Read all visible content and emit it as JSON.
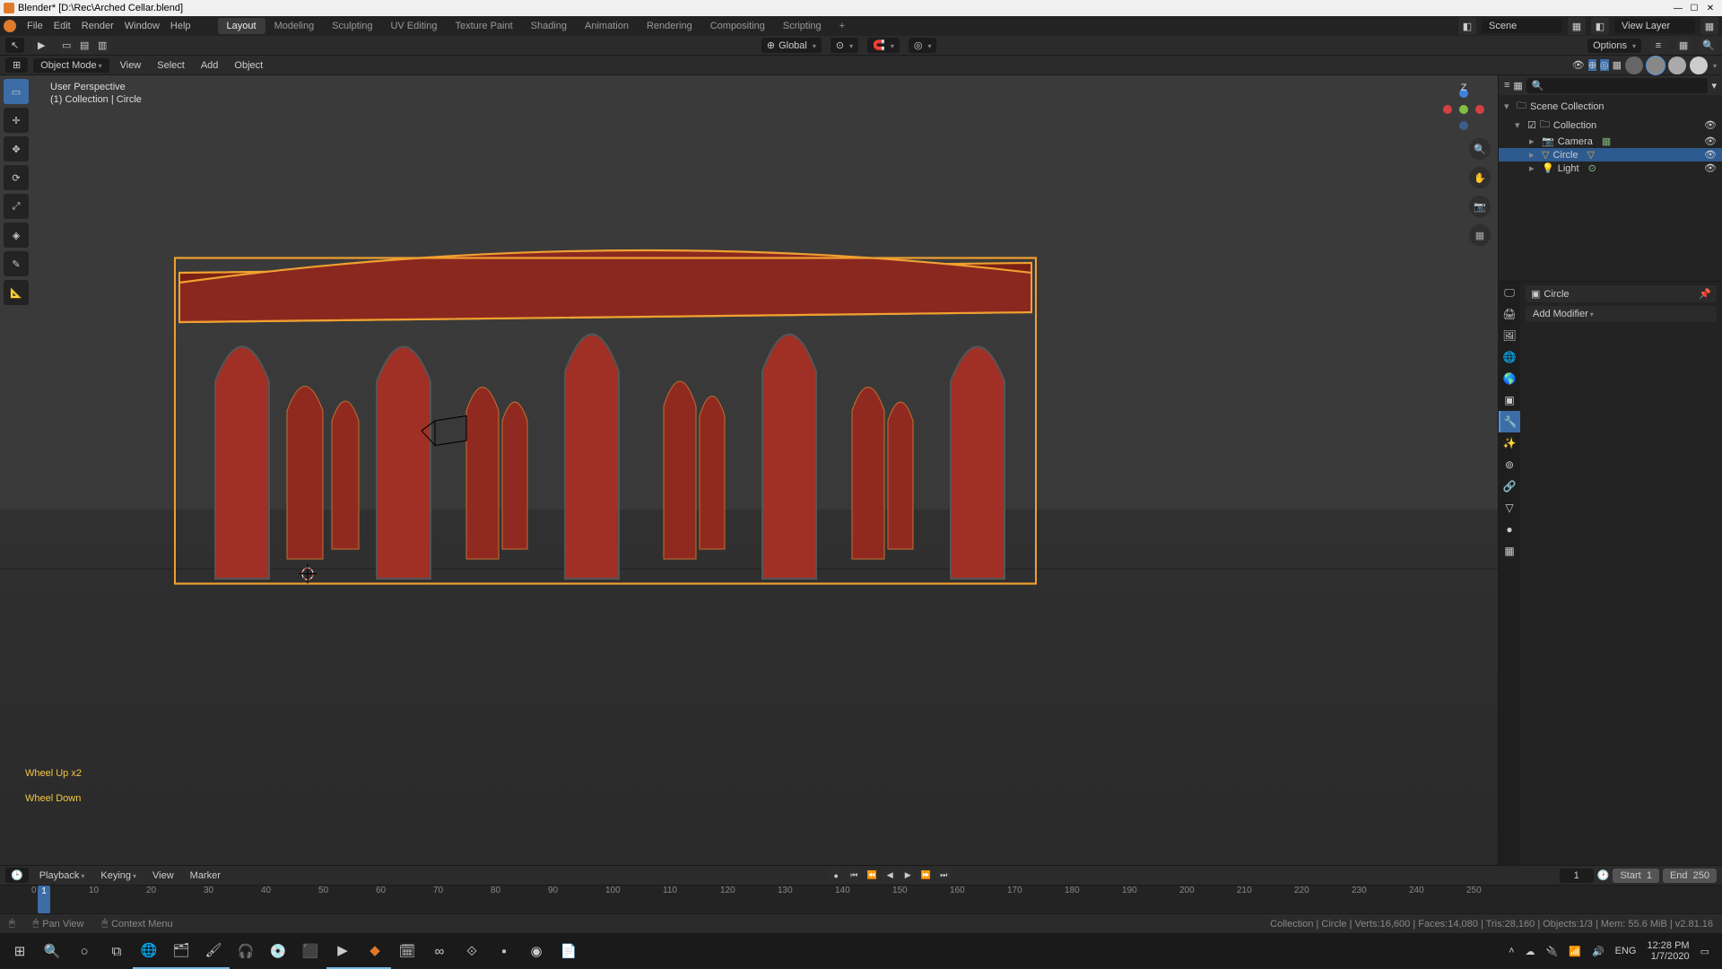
{
  "title": "Blender* [D:\\Rec\\Arched Cellar.blend]",
  "winbtns": {
    "min": "—",
    "max": "☐",
    "close": "✕"
  },
  "menu": {
    "file": "File",
    "edit": "Edit",
    "render": "Render",
    "window": "Window",
    "help": "Help"
  },
  "workspaces": {
    "layout": "Layout",
    "modeling": "Modeling",
    "sculpting": "Sculpting",
    "uv": "UV Editing",
    "texpaint": "Texture Paint",
    "shading": "Shading",
    "animation": "Animation",
    "rendering": "Rendering",
    "compositing": "Compositing",
    "scripting": "Scripting",
    "plus": "+"
  },
  "scene_field": "Scene",
  "viewlayer_field": "View Layer",
  "toolhdr": {
    "global": "Global",
    "options": "Options"
  },
  "mode_dd": "Object Mode",
  "viewmenu": {
    "view": "View",
    "select": "Select",
    "add": "Add",
    "object": "Object"
  },
  "viewport_info": {
    "line1": "User Perspective",
    "line2": "(1) Collection | Circle"
  },
  "scroll_overlay": {
    "l1": "Wheel Up x2",
    "l2": "Wheel Down"
  },
  "outliner": {
    "root": "Scene Collection",
    "collection": "Collection",
    "camera": "Camera",
    "circle": "Circle",
    "light": "Light"
  },
  "props": {
    "active_name": "Circle",
    "add_modifier": "Add Modifier"
  },
  "timeline_hdr": {
    "playback": "Playback",
    "keying": "Keying",
    "view": "View",
    "marker": "Marker",
    "current": "1",
    "start_label": "Start",
    "start": "1",
    "end_label": "End",
    "end": "250"
  },
  "ticks": [
    "0",
    "10",
    "20",
    "30",
    "40",
    "50",
    "60",
    "70",
    "80",
    "90",
    "100",
    "110",
    "120",
    "130",
    "140",
    "150",
    "160",
    "170",
    "180",
    "190",
    "200",
    "210",
    "220",
    "230",
    "240",
    "250"
  ],
  "status": {
    "pan": "Pan View",
    "ctx": "Context Menu",
    "stats": "Collection | Circle | Verts:16,600 | Faces:14,080 | Tris:28,160 | Objects:1/3 | Mem: 55.6 MiB | v2.81.16"
  },
  "tray": {
    "lang": "ENG",
    "net": "📶",
    "time": "12:28 PM",
    "date": "1/7/2020"
  }
}
